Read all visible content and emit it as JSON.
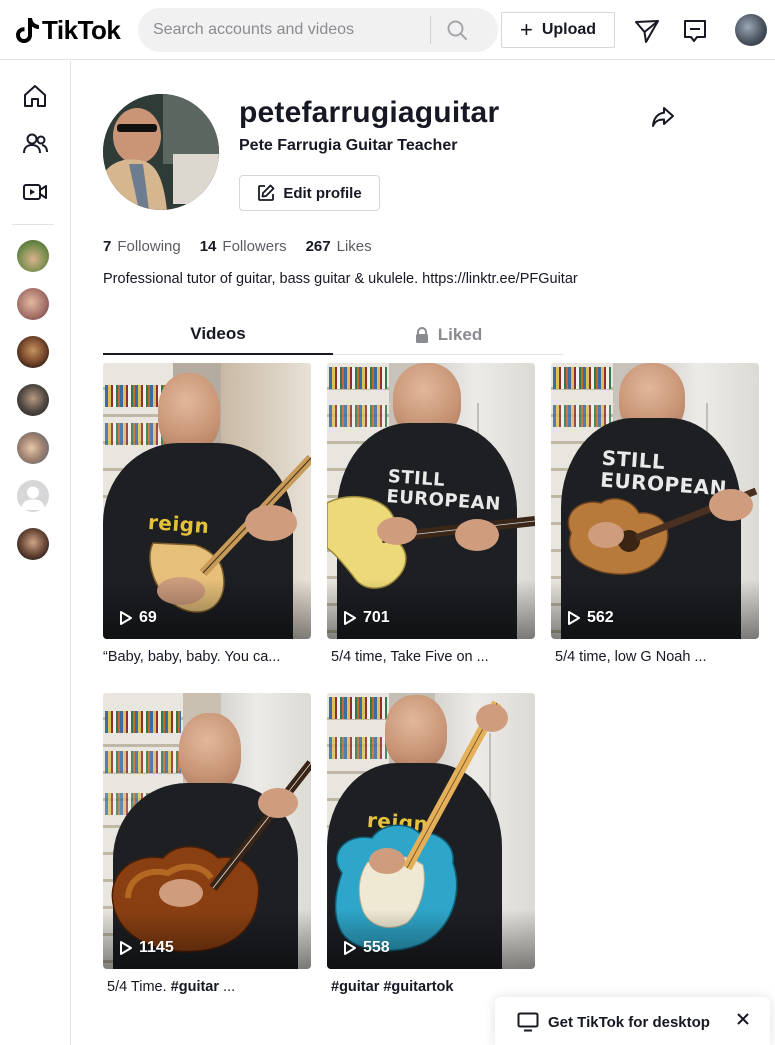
{
  "header": {
    "logo_text": "TikTok",
    "search_placeholder": "Search accounts and videos",
    "upload_label": "Upload"
  },
  "sidebar": {
    "nav": [
      "home-icon",
      "following-icon",
      "live-icon"
    ],
    "following_avatars": 7
  },
  "profile": {
    "username": "petefarrugiaguitar",
    "display_name": "Pete Farrugia Guitar Teacher",
    "edit_label": "Edit profile",
    "following_count": "7",
    "following_label": "Following",
    "followers_count": "14",
    "followers_label": "Followers",
    "likes_count": "267",
    "likes_label": "Likes",
    "bio": "Professional tutor of guitar, bass guitar & ukulele. https://linktr.ee/PFGuitar"
  },
  "tabs": {
    "videos": "Videos",
    "liked": "Liked"
  },
  "videos": [
    {
      "views": "69",
      "caption": "“Baby, baby, baby. You ca..."
    },
    {
      "views": "701",
      "caption": "5/4 time, Take Five on ..."
    },
    {
      "views": "562",
      "caption": "5/4 time, low G Noah ..."
    },
    {
      "views": "1145",
      "caption_prefix": "5/4 Time. ",
      "caption_bold": "#guitar",
      "caption_suffix": " ..."
    },
    {
      "views": "558",
      "caption_bold": "#guitar #guitartok"
    }
  ],
  "shirt_text": {
    "still_european_1": "STILL\nEUROPEAN",
    "still_european_2": "STILL\nEUROPEAN",
    "reign": "reign"
  },
  "desktop_prompt": {
    "label": "Get TikTok for desktop"
  },
  "colors": {
    "text_primary": "#161823",
    "text_secondary": "#8a8b91",
    "border": "#e3e3e4",
    "search_bg": "#f1f1f2"
  }
}
